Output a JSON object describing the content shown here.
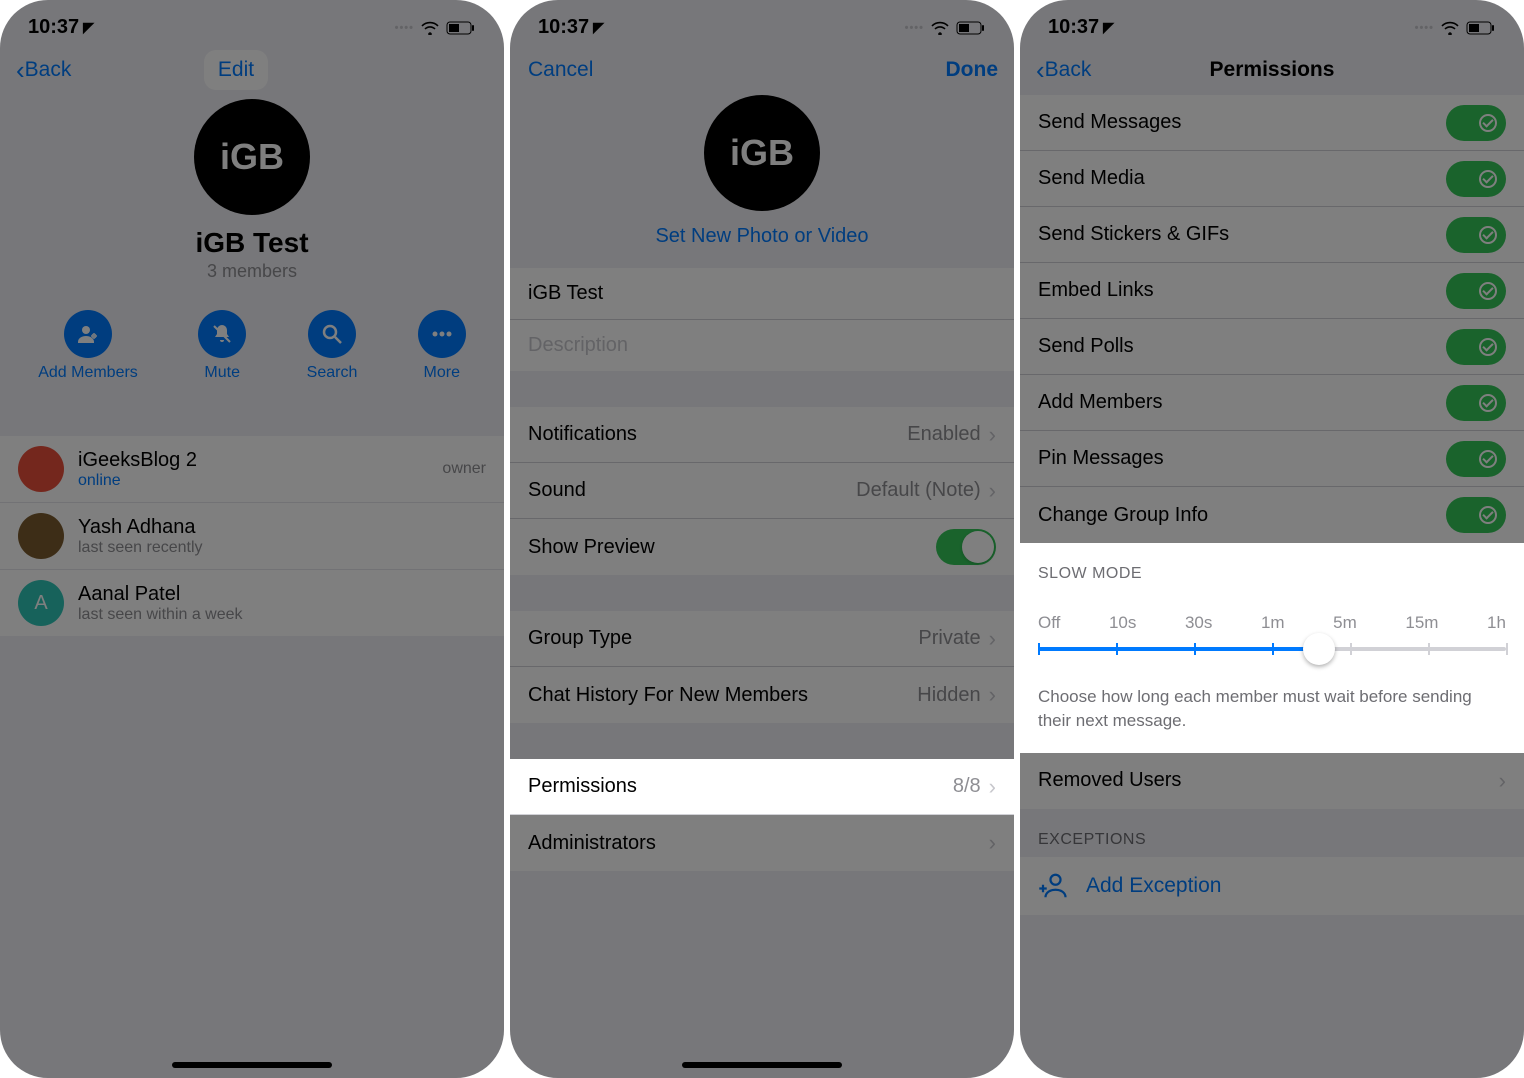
{
  "statusbar": {
    "time": "10:37"
  },
  "screen1": {
    "nav_back": "Back",
    "nav_edit": "Edit",
    "group_avatar_label": "iGB",
    "group_name": "iGB Test",
    "member_count": "3 members",
    "actions": {
      "add": "Add Members",
      "mute": "Mute",
      "search": "Search",
      "more": "More"
    },
    "members": [
      {
        "name": "iGeeksBlog 2",
        "status": "online",
        "badge": "owner",
        "color": "#e94f3a",
        "status_color": "#007aff"
      },
      {
        "name": "Yash Adhana",
        "status": "last seen recently",
        "badge": "",
        "color": "#7a5b2e",
        "status_color": "#8e8e93"
      },
      {
        "name": "Aanal Patel",
        "status": "last seen within a week",
        "badge": "",
        "color": "#2ec4b6",
        "initial": "A",
        "status_color": "#8e8e93"
      }
    ]
  },
  "screen2": {
    "nav_cancel": "Cancel",
    "nav_done": "Done",
    "avatar_label": "iGB",
    "set_photo": "Set New Photo or Video",
    "name_field": "iGB Test",
    "desc_placeholder": "Description",
    "rows": {
      "notifications": {
        "label": "Notifications",
        "value": "Enabled"
      },
      "sound": {
        "label": "Sound",
        "value": "Default (Note)"
      },
      "show_preview": {
        "label": "Show Preview"
      },
      "group_type": {
        "label": "Group Type",
        "value": "Private"
      },
      "chat_history": {
        "label": "Chat History For New Members",
        "value": "Hidden"
      },
      "permissions": {
        "label": "Permissions",
        "value": "8/8"
      },
      "administrators": {
        "label": "Administrators",
        "value": ""
      }
    }
  },
  "screen3": {
    "nav_back": "Back",
    "title": "Permissions",
    "perms": [
      "Send Messages",
      "Send Media",
      "Send Stickers & GIFs",
      "Embed Links",
      "Send Polls",
      "Add Members",
      "Pin Messages",
      "Change Group Info"
    ],
    "slowmode_header": "SLOW MODE",
    "slowmode_labels": [
      "Off",
      "10s",
      "30s",
      "1m",
      "5m",
      "15m",
      "1h"
    ],
    "slowmode_footer": "Choose how long each member must wait before sending their next message.",
    "removed_users": "Removed Users",
    "exceptions_header": "EXCEPTIONS",
    "add_exception": "Add Exception"
  }
}
